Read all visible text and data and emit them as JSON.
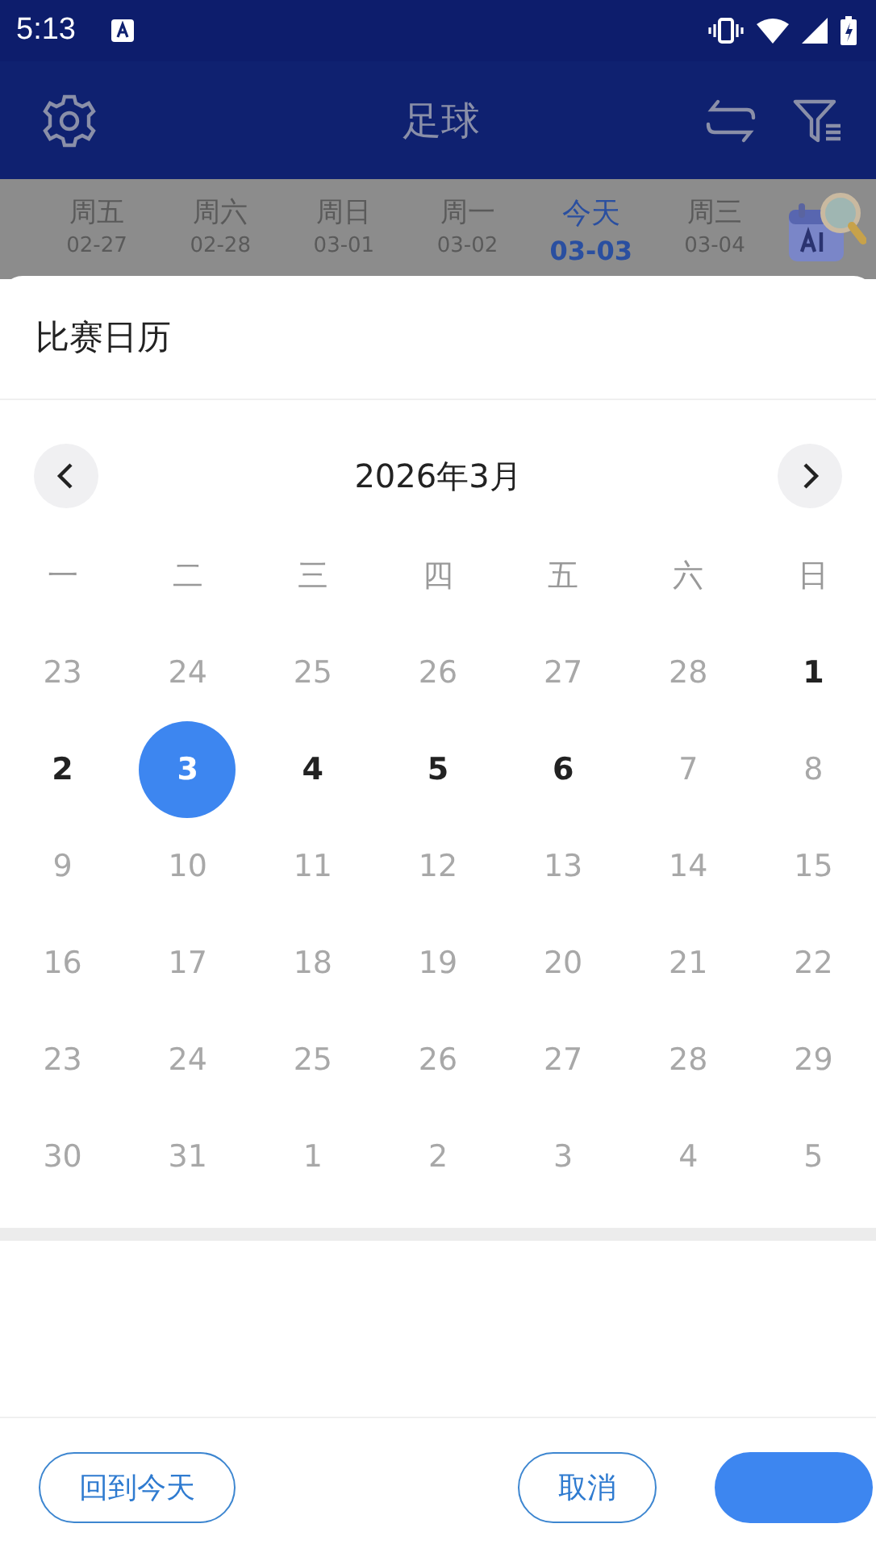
{
  "status_bar": {
    "time": "5:13"
  },
  "header": {
    "title": "足球"
  },
  "date_tabs": [
    {
      "weekday": "周五",
      "date": "02-27",
      "selected": false
    },
    {
      "weekday": "周六",
      "date": "02-28",
      "selected": false
    },
    {
      "weekday": "周日",
      "date": "03-01",
      "selected": false
    },
    {
      "weekday": "周一",
      "date": "03-02",
      "selected": false
    },
    {
      "weekday": "今天",
      "date": "03-03",
      "selected": true
    },
    {
      "weekday": "周三",
      "date": "03-04",
      "selected": false
    }
  ],
  "sheet": {
    "title": "比赛日历",
    "month": "2026年3月",
    "weekdays": [
      "一",
      "二",
      "三",
      "四",
      "五",
      "六",
      "日"
    ],
    "days": [
      {
        "label": "23",
        "disabled": true,
        "selected": false
      },
      {
        "label": "24",
        "disabled": true,
        "selected": false
      },
      {
        "label": "25",
        "disabled": true,
        "selected": false
      },
      {
        "label": "26",
        "disabled": true,
        "selected": false
      },
      {
        "label": "27",
        "disabled": true,
        "selected": false
      },
      {
        "label": "28",
        "disabled": true,
        "selected": false
      },
      {
        "label": "1",
        "disabled": false,
        "selected": false
      },
      {
        "label": "2",
        "disabled": false,
        "selected": false
      },
      {
        "label": "3",
        "disabled": false,
        "selected": true
      },
      {
        "label": "4",
        "disabled": false,
        "selected": false
      },
      {
        "label": "5",
        "disabled": false,
        "selected": false
      },
      {
        "label": "6",
        "disabled": false,
        "selected": false
      },
      {
        "label": "7",
        "disabled": true,
        "selected": false
      },
      {
        "label": "8",
        "disabled": true,
        "selected": false
      },
      {
        "label": "9",
        "disabled": true,
        "selected": false
      },
      {
        "label": "10",
        "disabled": true,
        "selected": false
      },
      {
        "label": "11",
        "disabled": true,
        "selected": false
      },
      {
        "label": "12",
        "disabled": true,
        "selected": false
      },
      {
        "label": "13",
        "disabled": true,
        "selected": false
      },
      {
        "label": "14",
        "disabled": true,
        "selected": false
      },
      {
        "label": "15",
        "disabled": true,
        "selected": false
      },
      {
        "label": "16",
        "disabled": true,
        "selected": false
      },
      {
        "label": "17",
        "disabled": true,
        "selected": false
      },
      {
        "label": "18",
        "disabled": true,
        "selected": false
      },
      {
        "label": "19",
        "disabled": true,
        "selected": false
      },
      {
        "label": "20",
        "disabled": true,
        "selected": false
      },
      {
        "label": "21",
        "disabled": true,
        "selected": false
      },
      {
        "label": "22",
        "disabled": true,
        "selected": false
      },
      {
        "label": "23",
        "disabled": true,
        "selected": false
      },
      {
        "label": "24",
        "disabled": true,
        "selected": false
      },
      {
        "label": "25",
        "disabled": true,
        "selected": false
      },
      {
        "label": "26",
        "disabled": true,
        "selected": false
      },
      {
        "label": "27",
        "disabled": true,
        "selected": false
      },
      {
        "label": "28",
        "disabled": true,
        "selected": false
      },
      {
        "label": "29",
        "disabled": true,
        "selected": false
      },
      {
        "label": "30",
        "disabled": true,
        "selected": false
      },
      {
        "label": "31",
        "disabled": true,
        "selected": false
      },
      {
        "label": "1",
        "disabled": true,
        "selected": false
      },
      {
        "label": "2",
        "disabled": true,
        "selected": false
      },
      {
        "label": "3",
        "disabled": true,
        "selected": false
      },
      {
        "label": "4",
        "disabled": true,
        "selected": false
      },
      {
        "label": "5",
        "disabled": true,
        "selected": false
      }
    ],
    "buttons": [
      {
        "label": "回到今天",
        "kind": "outline"
      },
      {
        "label": "取消",
        "kind": "outline"
      },
      {
        "kind": "filled"
      }
    ]
  }
}
